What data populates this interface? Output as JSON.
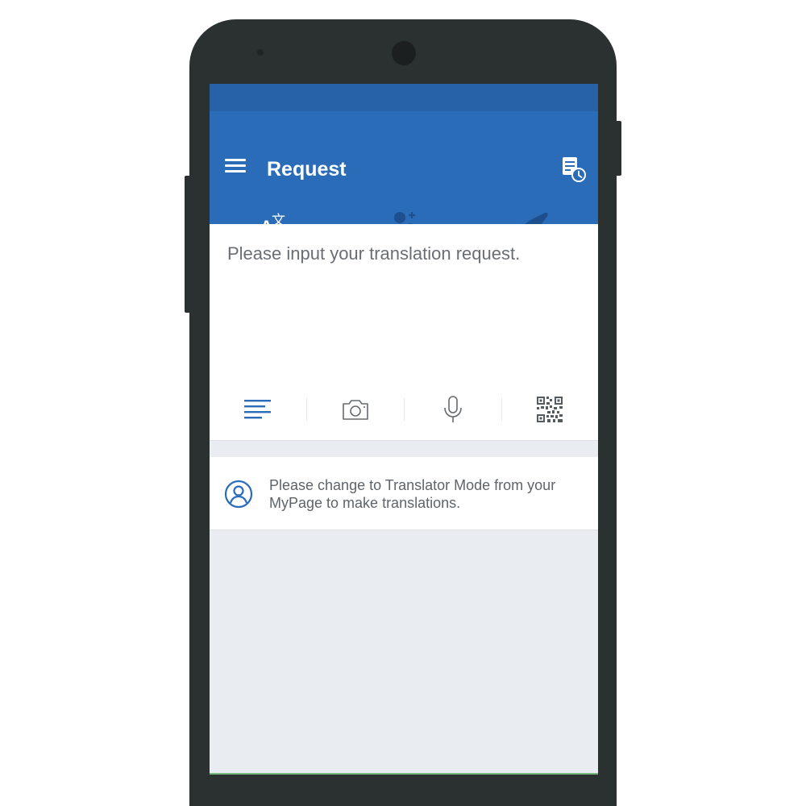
{
  "app_bar": {
    "title": "Request",
    "menu_icon": "hamburger-menu-icon",
    "history_icon": "request-history-icon"
  },
  "tabs": [
    {
      "icon": "translate-icon",
      "selected": true
    },
    {
      "icon": "find-translator-icon",
      "selected": false
    },
    {
      "icon": "airplane-icon",
      "selected": false
    }
  ],
  "request": {
    "placeholder": "Please input your translation request.",
    "value": ""
  },
  "input_tools": [
    {
      "icon": "text-input-icon"
    },
    {
      "icon": "camera-icon"
    },
    {
      "icon": "microphone-icon"
    },
    {
      "icon": "qr-code-icon"
    }
  ],
  "notice": {
    "icon": "user-profile-icon",
    "text": "Please change to Translator Mode from your MyPage to make translations."
  },
  "colors": {
    "primary": "#2b6cb9",
    "status_bar": "#2761a7",
    "accent_icon": "#2b6cb9",
    "screen_background": "#e9ecf1",
    "phone_body": "#2b3131"
  }
}
